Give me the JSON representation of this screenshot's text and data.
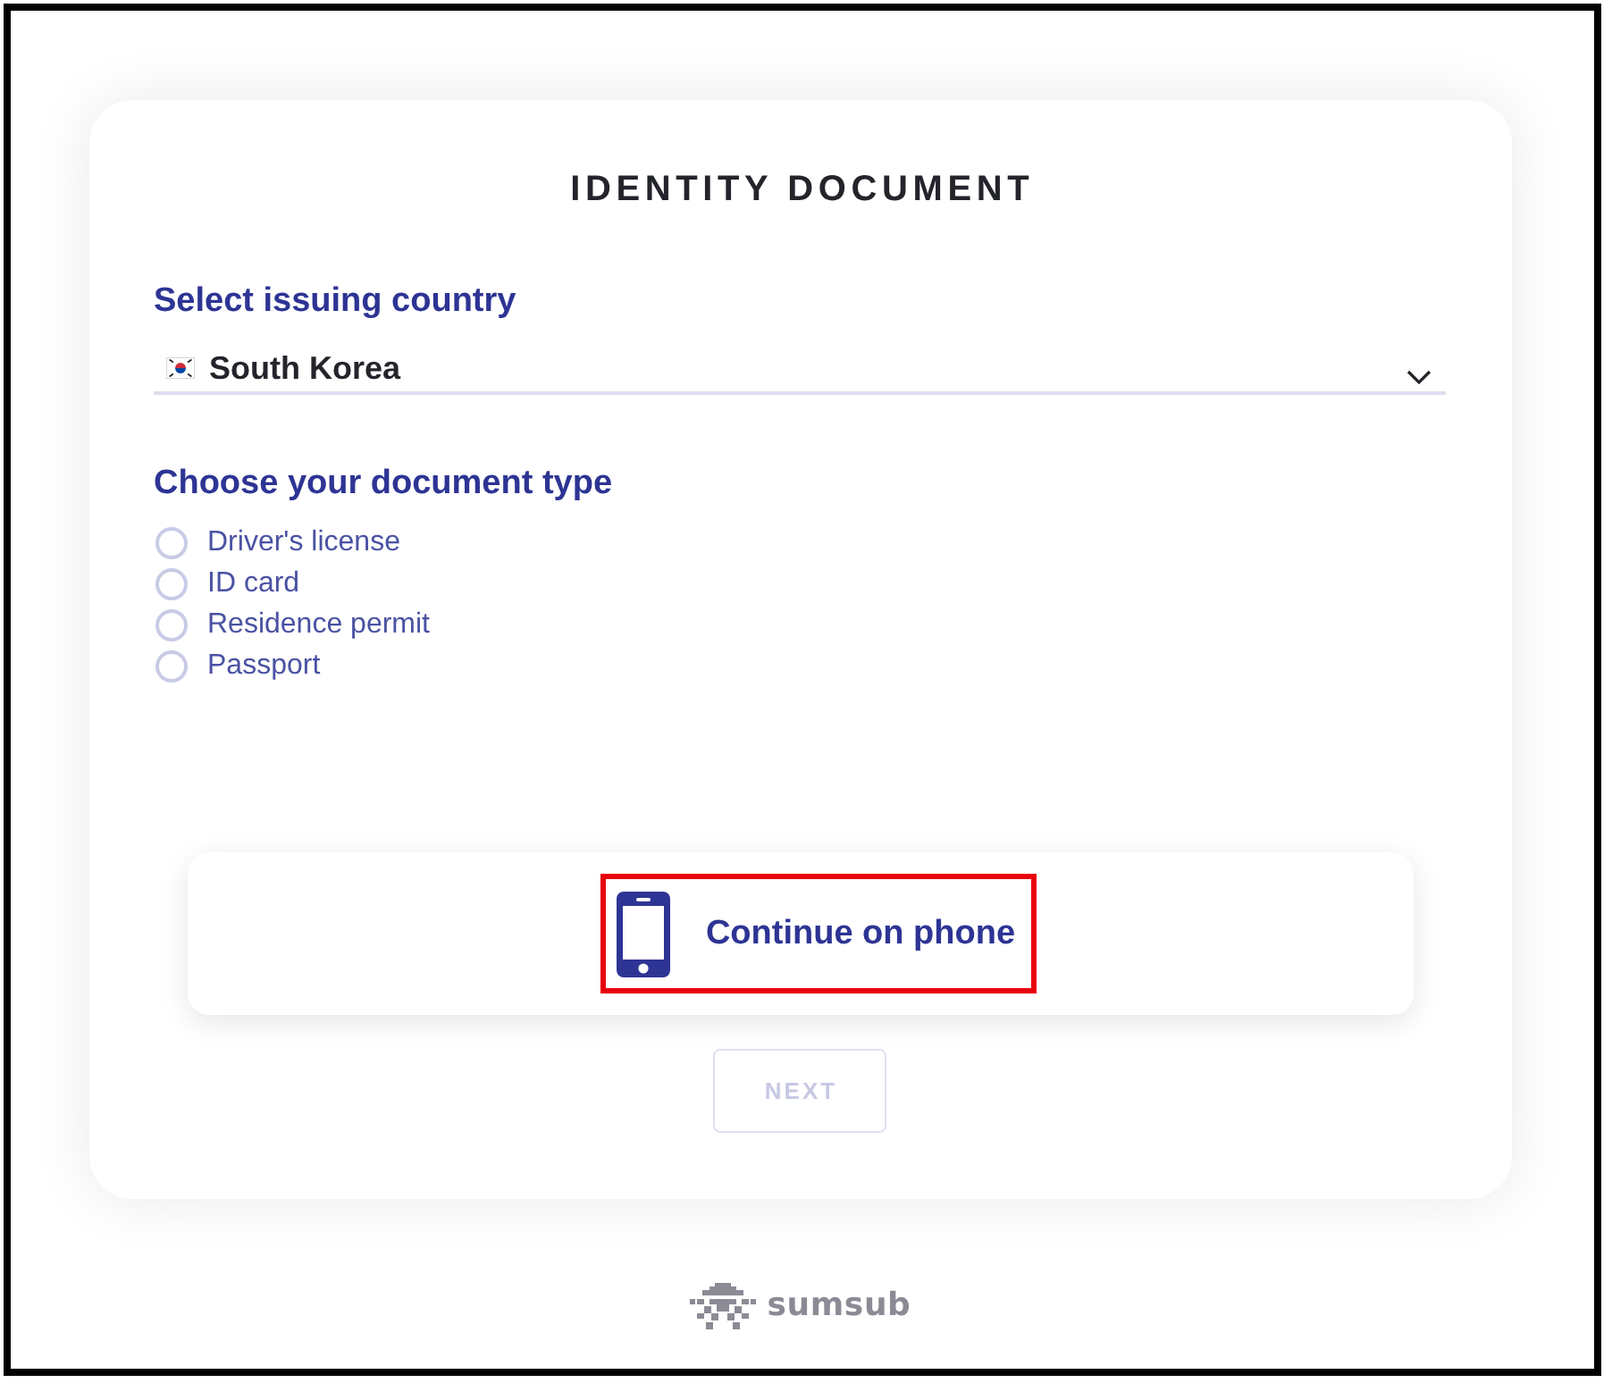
{
  "title": "IDENTITY DOCUMENT",
  "country": {
    "label": "Select issuing country",
    "value": "South Korea"
  },
  "document_type": {
    "label": "Choose your document type",
    "options": [
      {
        "label": "Driver's license",
        "selected": false
      },
      {
        "label": "ID card",
        "selected": false
      },
      {
        "label": "Residence permit",
        "selected": false
      },
      {
        "label": "Passport",
        "selected": false
      }
    ]
  },
  "continue_on_phone": {
    "label": "Continue on phone",
    "highlighted": true
  },
  "next_button": {
    "label": "NEXT",
    "disabled": true
  },
  "footer": {
    "brand": "sumsub"
  }
}
